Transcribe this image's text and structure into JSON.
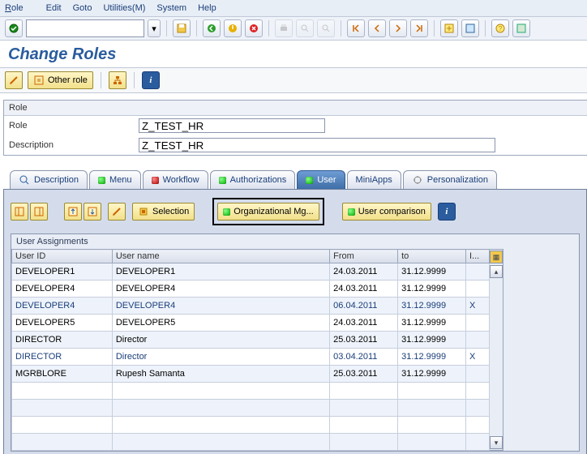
{
  "menu": {
    "role": "Role",
    "edit": "Edit",
    "goto": "Goto",
    "utilities": "Utilities(M)",
    "system": "System",
    "help": "Help"
  },
  "title": "Change Roles",
  "toolbar2": {
    "other_role": "Other role"
  },
  "panel": {
    "heading": "Role",
    "role_label": "Role",
    "role_value": "Z_TEST_HR",
    "desc_label": "Description",
    "desc_value": "Z_TEST_HR"
  },
  "tabs": {
    "description": "Description",
    "menu": "Menu",
    "workflow": "Workflow",
    "authorizations": "Authorizations",
    "user": "User",
    "miniapps": "MiniApps",
    "personalization": "Personalization"
  },
  "actions": {
    "selection": "Selection",
    "orgmgmt": "Organizational Mg...",
    "usercomp": "User comparison"
  },
  "grid": {
    "title": "User Assignments",
    "cols": {
      "userid": "User ID",
      "username": "User name",
      "from": "From",
      "to": "to",
      "ind": "I..."
    },
    "rows": [
      {
        "userid": "DEVELOPER1",
        "username": "DEVELOPER1",
        "from": "24.03.2011",
        "to": "31.12.9999",
        "ind": "",
        "link": false
      },
      {
        "userid": "DEVELOPER4",
        "username": "DEVELOPER4",
        "from": "24.03.2011",
        "to": "31.12.9999",
        "ind": "",
        "link": false
      },
      {
        "userid": "DEVELOPER4",
        "username": "DEVELOPER4",
        "from": "06.04.2011",
        "to": "31.12.9999",
        "ind": "X",
        "link": true
      },
      {
        "userid": "DEVELOPER5",
        "username": "DEVELOPER5",
        "from": "24.03.2011",
        "to": "31.12.9999",
        "ind": "",
        "link": false
      },
      {
        "userid": "DIRECTOR",
        "username": "Director",
        "from": "25.03.2011",
        "to": "31.12.9999",
        "ind": "",
        "link": false
      },
      {
        "userid": "DIRECTOR",
        "username": "Director",
        "from": "03.04.2011",
        "to": "31.12.9999",
        "ind": "X",
        "link": true
      },
      {
        "userid": "MGRBLORE",
        "username": "Rupesh Samanta",
        "from": "25.03.2011",
        "to": "31.12.9999",
        "ind": "",
        "link": false
      }
    ]
  }
}
